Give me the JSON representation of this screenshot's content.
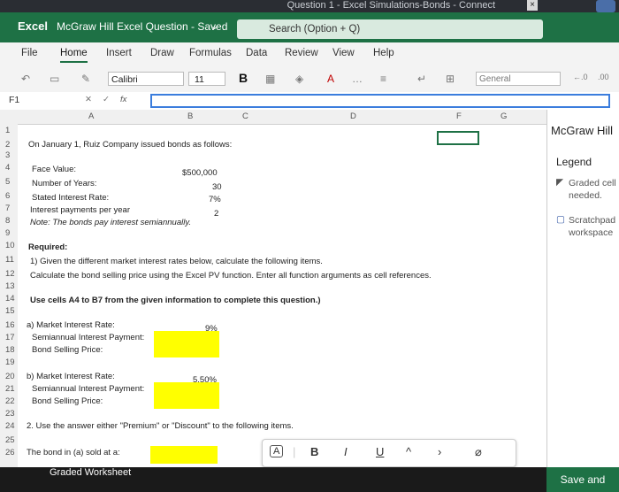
{
  "os": {
    "window_title": "Question 1 - Excel Simulations-Bonds - Connect"
  },
  "app": {
    "name": "Excel",
    "doc_title": "McGraw Hill Excel Question - Saved",
    "search_placeholder": "Search (Option + Q)"
  },
  "ribbon_tabs": [
    "File",
    "Home",
    "Insert",
    "Draw",
    "Formulas",
    "Data",
    "Review",
    "View",
    "Help"
  ],
  "toolbar": {
    "font": "Calibri",
    "size": "11",
    "bold": "B",
    "number_format": "General"
  },
  "formula_bar": {
    "name_box": "F1",
    "fx": "fx"
  },
  "columns": [
    "A",
    "B",
    "C",
    "D",
    "F",
    "G"
  ],
  "rows": [
    "1",
    "2",
    "3",
    "4",
    "5",
    "6",
    "7",
    "8",
    "9",
    "10",
    "11",
    "12",
    "13",
    "14",
    "15",
    "16",
    "17",
    "18",
    "19",
    "20",
    "21",
    "22",
    "23",
    "24",
    "25",
    "26"
  ],
  "cells": {
    "r2": "On January 1, Ruiz Company issued bonds as follows:",
    "r4a": "Face Value:",
    "r4b": "$500,000",
    "r5a": "Number of Years:",
    "r5b": "30",
    "r6a": "Stated Interest Rate:",
    "r6b": "7%",
    "r7a": "Interest payments per year",
    "r7b": "2",
    "r8a": "Note: The bonds pay interest semiannually.",
    "r10": "Required:",
    "r11": "1) Given the different market interest rates below, calculate the following items.",
    "r12": "Calculate the bond selling price using the Excel PV function. Enter all function arguments as cell references.",
    "r14": "Use cells A4 to B7 from the given information to complete this question.)",
    "r16a": "a) Market Interest Rate:",
    "r16b": "9%",
    "r17a": "Semiannual Interest Payment:",
    "r18a": "Bond Selling Price:",
    "r20a": "b) Market Interest Rate:",
    "r20b": "5.50%",
    "r21a": "Semiannual Interest Payment:",
    "r22a": "Bond Selling Price:",
    "r24": "2. Use the answer either \"Premium\" or \"Discount\" to the following items.",
    "r26a": "The bond in (a) sold at a:"
  },
  "right_panel": {
    "title": "McGraw Hill",
    "legend": "Legend",
    "graded": "Graded cell needed.",
    "scratch": "Scratchpad workspace"
  },
  "float_toolbar": {
    "a": "A",
    "b": "B",
    "i": "I",
    "u": "U"
  },
  "bottom": {
    "sheet_tab": "Graded Worksheet",
    "save": "Save and"
  }
}
